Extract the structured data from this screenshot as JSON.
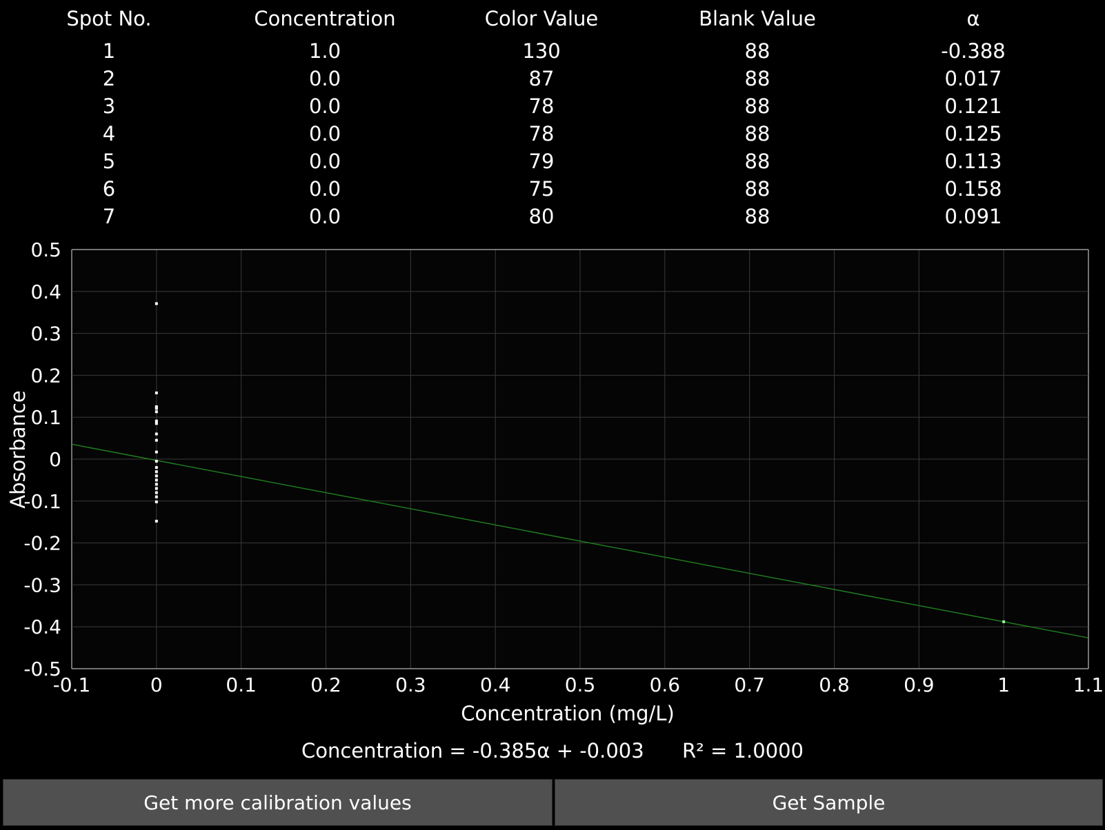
{
  "table": {
    "headers": [
      "Spot No.",
      "Concentration",
      "Color Value",
      "Blank Value",
      "α"
    ],
    "rows": [
      [
        "1",
        "1.0",
        "130",
        "88",
        "-0.388"
      ],
      [
        "2",
        "0.0",
        "87",
        "88",
        "0.017"
      ],
      [
        "3",
        "0.0",
        "78",
        "88",
        "0.121"
      ],
      [
        "4",
        "0.0",
        "78",
        "88",
        "0.125"
      ],
      [
        "5",
        "0.0",
        "79",
        "88",
        "0.113"
      ],
      [
        "6",
        "0.0",
        "75",
        "88",
        "0.158"
      ],
      [
        "7",
        "0.0",
        "80",
        "88",
        "0.091"
      ]
    ]
  },
  "chart_data": {
    "type": "scatter",
    "xlabel": "Concentration (mg/L)",
    "ylabel": "Absorbance",
    "xlim": [
      -0.1,
      1.1
    ],
    "ylim": [
      -0.5,
      0.5
    ],
    "xticks": [
      "-0.1",
      "0",
      "0.1",
      "0.2",
      "0.3",
      "0.4",
      "0.5",
      "0.6",
      "0.7",
      "0.8",
      "0.9",
      "1",
      "1.1"
    ],
    "yticks": [
      "0.5",
      "0.4",
      "0.3",
      "0.2",
      "0.1",
      "0",
      "-0.1",
      "-0.2",
      "-0.3",
      "-0.4",
      "-0.5"
    ],
    "grid": true,
    "series": [
      {
        "points": [
          [
            1.0,
            -0.388
          ],
          [
            0,
            0.371
          ],
          [
            0,
            0.158
          ],
          [
            0,
            0.125
          ],
          [
            0,
            0.121
          ],
          [
            0,
            0.113
          ],
          [
            0,
            0.091
          ],
          [
            0,
            0.085
          ],
          [
            0,
            0.06
          ],
          [
            0,
            0.045
          ],
          [
            0,
            0.017
          ],
          [
            0,
            -0.005
          ],
          [
            0,
            -0.02
          ],
          [
            0,
            -0.03
          ],
          [
            0,
            -0.04
          ],
          [
            0,
            -0.05
          ],
          [
            0,
            -0.06
          ],
          [
            0,
            -0.07
          ],
          [
            0,
            -0.08
          ],
          [
            0,
            -0.09
          ],
          [
            0,
            -0.102
          ],
          [
            0,
            -0.148
          ]
        ],
        "color": "#ffffff"
      }
    ],
    "fit_line": {
      "x": [
        -0.1,
        1.1
      ],
      "y": [
        0.0355,
        -0.4265
      ],
      "color": "#1f7a1f"
    },
    "point_color": "#ffffff",
    "highlight_color": "#8cff8c"
  },
  "equation": {
    "formula": "Concentration = -0.385α + -0.003",
    "r_squared": "R² = 1.0000"
  },
  "buttons": {
    "more_label": "Get more calibration values",
    "sample_label": "Get Sample"
  }
}
